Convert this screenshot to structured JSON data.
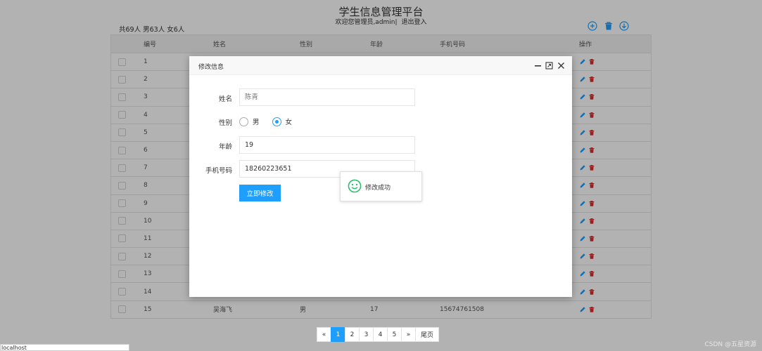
{
  "header": {
    "title": "学生信息管理平台",
    "welcome": "欢迎您管理员,admin|",
    "logout": "退出登入",
    "summary": "共69人 男63人 女6人"
  },
  "toolbar": {
    "icons": [
      "add-circle-icon",
      "trash-icon",
      "download-icon"
    ]
  },
  "table": {
    "headers": {
      "id": "编号",
      "name": "姓名",
      "gender": "性别",
      "age": "年龄",
      "phone": "手机号码",
      "ops": "操作"
    },
    "rows": [
      {
        "id": "1",
        "name": "",
        "gender": "",
        "age": "",
        "phone": ""
      },
      {
        "id": "2",
        "name": "",
        "gender": "",
        "age": "",
        "phone": ""
      },
      {
        "id": "3",
        "name": "",
        "gender": "",
        "age": "",
        "phone": ""
      },
      {
        "id": "4",
        "name": "",
        "gender": "",
        "age": "",
        "phone": ""
      },
      {
        "id": "5",
        "name": "",
        "gender": "",
        "age": "",
        "phone": ""
      },
      {
        "id": "6",
        "name": "",
        "gender": "",
        "age": "",
        "phone": ""
      },
      {
        "id": "7",
        "name": "",
        "gender": "",
        "age": "",
        "phone": ""
      },
      {
        "id": "8",
        "name": "",
        "gender": "",
        "age": "",
        "phone": ""
      },
      {
        "id": "9",
        "name": "",
        "gender": "",
        "age": "",
        "phone": ""
      },
      {
        "id": "10",
        "name": "",
        "gender": "",
        "age": "",
        "phone": ""
      },
      {
        "id": "11",
        "name": "",
        "gender": "",
        "age": "",
        "phone": ""
      },
      {
        "id": "12",
        "name": "",
        "gender": "",
        "age": "",
        "phone": ""
      },
      {
        "id": "13",
        "name": "",
        "gender": "",
        "age": "",
        "phone": ""
      },
      {
        "id": "14",
        "name": "",
        "gender": "",
        "age": "",
        "phone": ""
      },
      {
        "id": "15",
        "name": "吴海飞",
        "gender": "男",
        "age": "17",
        "phone": "15674761508"
      }
    ]
  },
  "dialog": {
    "title": "修改信息",
    "fields": {
      "name_label": "姓名",
      "name_placeholder": "陈青",
      "gender_label": "性别",
      "gender_options": [
        "男",
        "女"
      ],
      "gender_selected": "女",
      "age_label": "年龄",
      "age_value": "19",
      "phone_label": "手机号码",
      "phone_value": "18260223651"
    },
    "submit": "立即修改"
  },
  "toast": {
    "text": "修改成功"
  },
  "pagination": {
    "prev": "«",
    "pages": [
      "1",
      "2",
      "3",
      "4",
      "5"
    ],
    "current": "1",
    "next": "»",
    "last": "尾页"
  },
  "status_bar": {
    "url": "localhost"
  },
  "watermark": "CSDN @五星资源",
  "colors": {
    "accent": "#1e9fff",
    "delete": "#e02c2c",
    "toast_icon": "#2dbf6f"
  }
}
